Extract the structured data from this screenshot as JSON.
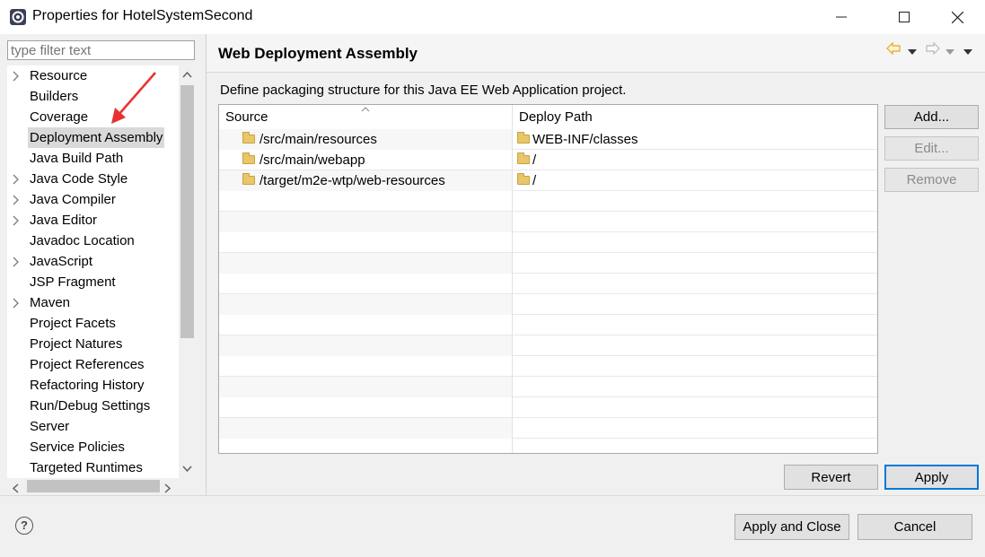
{
  "window": {
    "title": "Properties for HotelSystemSecond",
    "minimize": "─",
    "maximize": "☐",
    "close": "✕"
  },
  "filter": {
    "placeholder": "type filter text"
  },
  "tree": {
    "items": [
      {
        "label": "Resource",
        "expandable": true
      },
      {
        "label": "Builders",
        "expandable": false
      },
      {
        "label": "Coverage",
        "expandable": false
      },
      {
        "label": "Deployment Assembly",
        "expandable": false,
        "selected": true
      },
      {
        "label": "Java Build Path",
        "expandable": false
      },
      {
        "label": "Java Code Style",
        "expandable": true
      },
      {
        "label": "Java Compiler",
        "expandable": true
      },
      {
        "label": "Java Editor",
        "expandable": true
      },
      {
        "label": "Javadoc Location",
        "expandable": false
      },
      {
        "label": "JavaScript",
        "expandable": true
      },
      {
        "label": "JSP Fragment",
        "expandable": false
      },
      {
        "label": "Maven",
        "expandable": true
      },
      {
        "label": "Project Facets",
        "expandable": false
      },
      {
        "label": "Project Natures",
        "expandable": false
      },
      {
        "label": "Project References",
        "expandable": false
      },
      {
        "label": "Refactoring History",
        "expandable": false
      },
      {
        "label": "Run/Debug Settings",
        "expandable": false
      },
      {
        "label": "Server",
        "expandable": false
      },
      {
        "label": "Service Policies",
        "expandable": false
      },
      {
        "label": "Targeted Runtimes",
        "expandable": false
      }
    ]
  },
  "page": {
    "title": "Web Deployment Assembly",
    "description": "Define packaging structure for this Java EE Web Application project."
  },
  "table": {
    "headers": {
      "source": "Source",
      "deploy": "Deploy Path"
    },
    "rows": [
      {
        "source": "/src/main/resources",
        "deploy": "WEB-INF/classes"
      },
      {
        "source": "/src/main/webapp",
        "deploy": "/"
      },
      {
        "source": "/target/m2e-wtp/web-resources",
        "deploy": "/"
      }
    ]
  },
  "buttons": {
    "add": "Add...",
    "edit": "Edit...",
    "remove": "Remove",
    "revert": "Revert",
    "apply": "Apply",
    "apply_close": "Apply and Close",
    "cancel": "Cancel",
    "help": "?"
  },
  "colors": {
    "accent": "#0078d7",
    "arrow_annotation": "#e8312f",
    "back_arrow": "#e0a82e"
  }
}
